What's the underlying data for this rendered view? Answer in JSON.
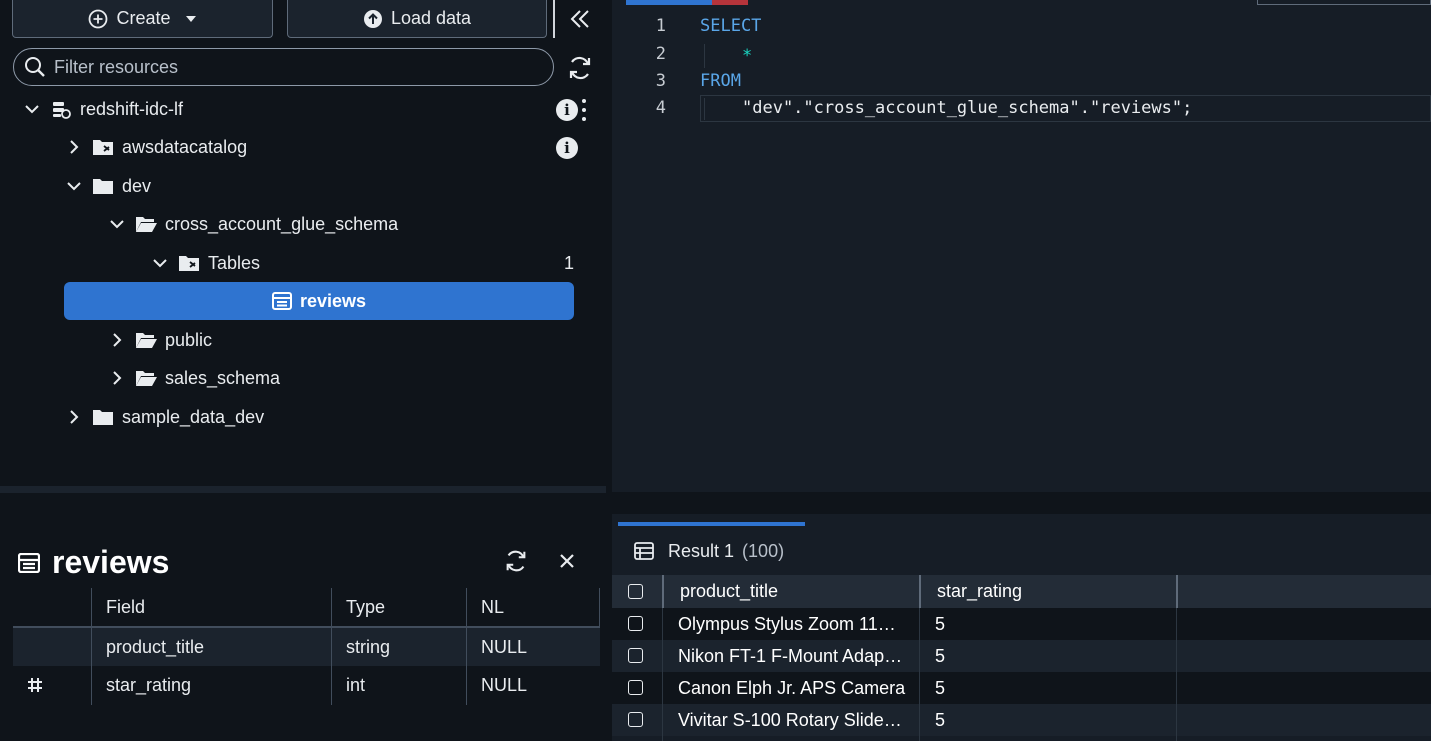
{
  "toolbar": {
    "create_label": "Create",
    "load_label": "Load data"
  },
  "search": {
    "placeholder": "Filter resources"
  },
  "tree": {
    "connection": "redshift-idc-lf",
    "awsdatacatalog": "awsdatacatalog",
    "dev": "dev",
    "schema": "cross_account_glue_schema",
    "tables": "Tables",
    "tables_count": "1",
    "selected_table": "reviews",
    "public": "public",
    "sales_schema": "sales_schema",
    "sample_data_dev": "sample_data_dev"
  },
  "details": {
    "title": "reviews",
    "headers": [
      "Field",
      "Type",
      "NL"
    ],
    "rows": [
      {
        "field": "product_title",
        "type": "string",
        "nl": "NULL"
      },
      {
        "field": "star_rating",
        "type": "int",
        "nl": "NULL"
      }
    ]
  },
  "editor": {
    "lines": [
      {
        "num": "1",
        "text": "SELECT"
      },
      {
        "num": "2",
        "text": "*"
      },
      {
        "num": "3",
        "text": "FROM"
      },
      {
        "num": "4",
        "text": "\"dev\".\"cross_account_glue_schema\".\"reviews\";"
      }
    ]
  },
  "results": {
    "tab_label": "Result 1",
    "tab_count": "(100)",
    "headers": [
      "product_title",
      "star_rating"
    ],
    "rows": [
      {
        "product_title": "Olympus Stylus Zoom 11…",
        "star_rating": "5"
      },
      {
        "product_title": "Nikon FT-1 F-Mount Adap…",
        "star_rating": "5"
      },
      {
        "product_title": "Canon Elph Jr. APS Camera",
        "star_rating": "5"
      },
      {
        "product_title": "Vivitar S-100 Rotary Slide…",
        "star_rating": "5"
      }
    ]
  },
  "colors": {
    "accent": "#2f74d0",
    "background": "#0f141a",
    "editor_bg": "#161d26",
    "keyword": "#5aa6e8"
  }
}
